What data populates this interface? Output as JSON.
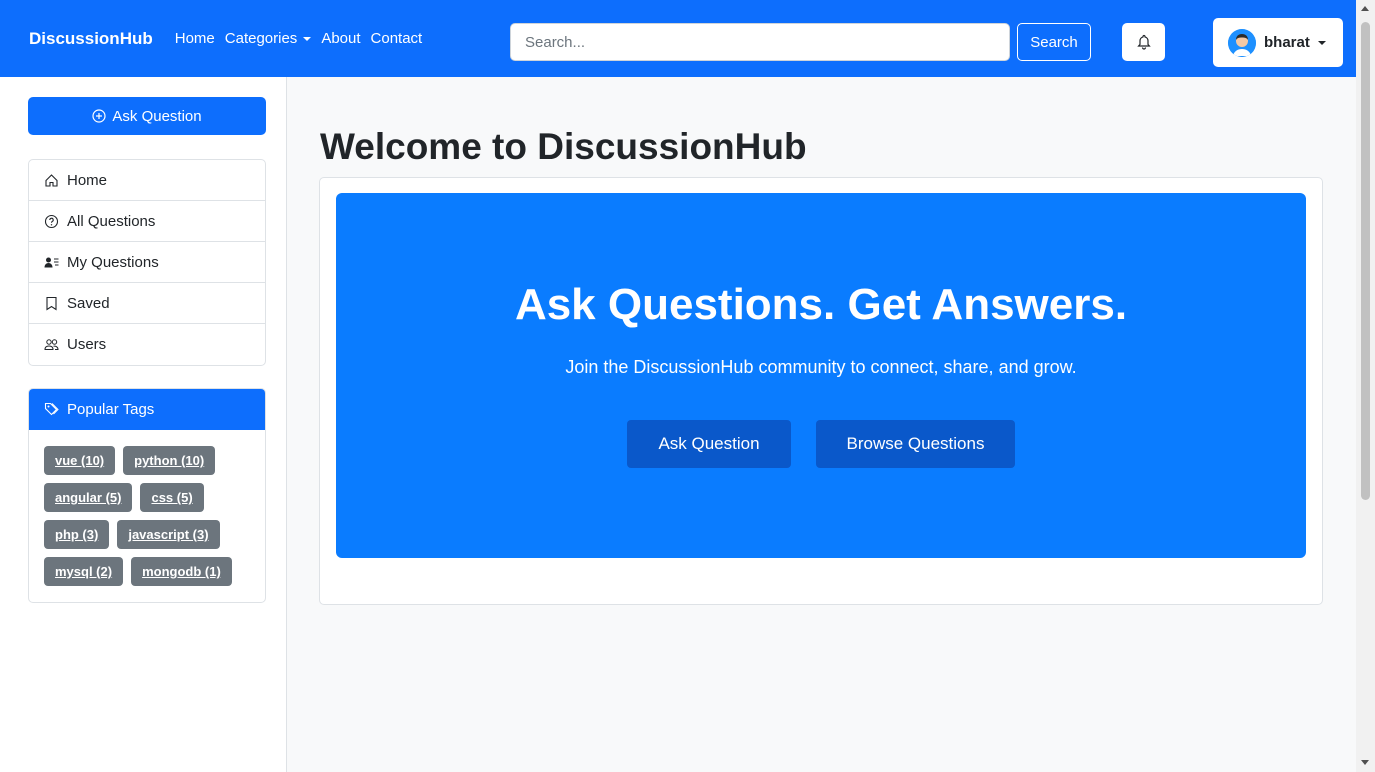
{
  "navbar": {
    "brand": "DiscussionHub",
    "links": [
      "Home",
      "Categories",
      "About",
      "Contact"
    ],
    "search_placeholder": "Search...",
    "search_button": "Search",
    "user_name": "bharat"
  },
  "sidebar": {
    "ask_button": "Ask Question",
    "menu": [
      "Home",
      "All Questions",
      "My Questions",
      "Saved",
      "Users"
    ],
    "tags_title": "Popular Tags",
    "tags": [
      "vue (10)",
      "python (10)",
      "angular (5)",
      "css (5)",
      "php (3)",
      "javascript (3)",
      "mysql (2)",
      "mongodb (1)"
    ]
  },
  "main": {
    "title": "Welcome to DiscussionHub",
    "hero_title": "Ask Questions. Get Answers.",
    "hero_subtitle": "Join the DiscussionHub community to connect, share, and grow.",
    "hero_ask_button": "Ask Question",
    "hero_browse_button": "Browse Questions"
  },
  "colors": {
    "primary": "#0d6efd",
    "hero": "#0a7cff",
    "hero_button": "#0a58ca",
    "tag": "#6c757d"
  }
}
